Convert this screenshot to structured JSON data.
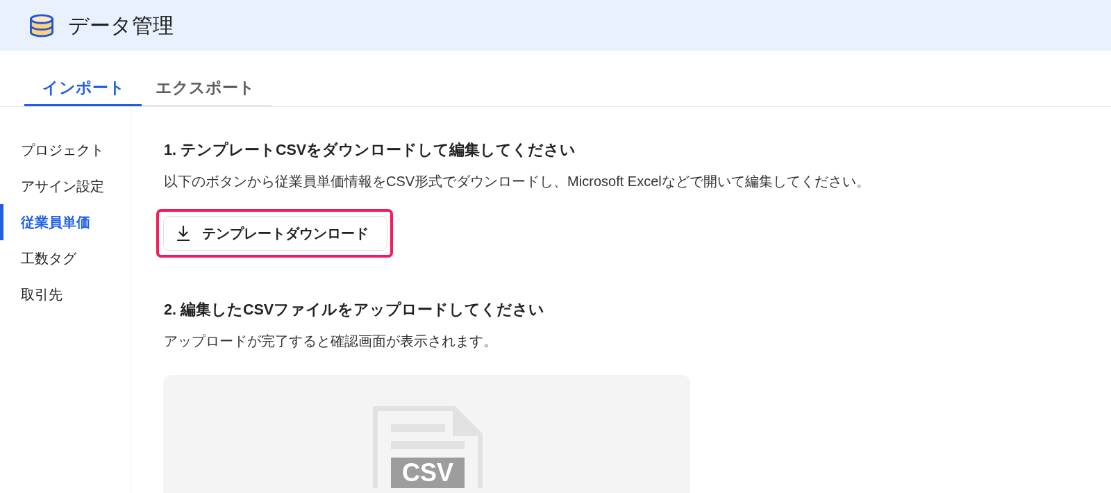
{
  "header": {
    "title": "データ管理"
  },
  "tabs": [
    {
      "label": "インポート",
      "selected": true
    },
    {
      "label": "エクスポート",
      "selected": false
    }
  ],
  "sidebar": {
    "items": [
      {
        "label": "プロジェクト",
        "selected": false
      },
      {
        "label": "アサイン設定",
        "selected": false
      },
      {
        "label": "従業員単価",
        "selected": true
      },
      {
        "label": "工数タグ",
        "selected": false
      },
      {
        "label": "取引先",
        "selected": false
      }
    ]
  },
  "steps": [
    {
      "kind": "download",
      "heading": "1. テンプレートCSVをダウンロードして編集してください",
      "description": "以下のボタンから従業員単価情報をCSV形式でダウンロードし、Microsoft Excelなどで開いて編集してください。",
      "button": {
        "label": "テンプレートダウンロード",
        "highlighted": true
      }
    },
    {
      "kind": "upload",
      "heading": "2. 編集したCSVファイルをアップロードしてください",
      "description": "アップロードが完了すると確認画面が表示されます。",
      "dropzone": {
        "file_label": "CSV"
      }
    }
  ]
}
